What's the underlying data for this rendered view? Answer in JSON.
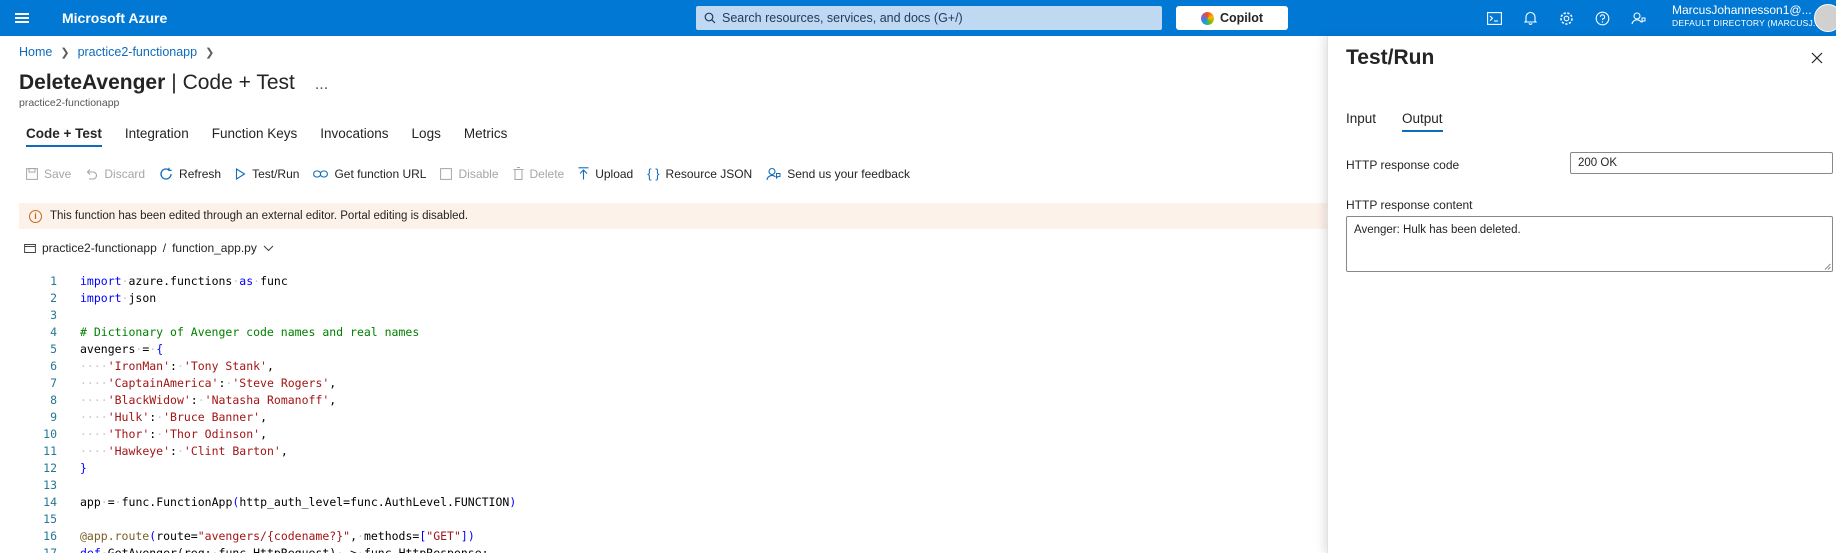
{
  "topbar": {
    "brand": "Microsoft Azure",
    "search_placeholder": "Search resources, services, and docs (G+/)",
    "copilot_label": "Copilot",
    "account_name": "MarcusJohannesson1@...",
    "account_directory": "DEFAULT DIRECTORY (MARCUSJ...",
    "icons": [
      "cloud-shell-icon",
      "bell-icon",
      "gear-icon",
      "help-icon",
      "feedback-icon"
    ]
  },
  "breadcrumb": {
    "home": "Home",
    "app": "practice2-functionapp"
  },
  "header": {
    "title_bold": "DeleteAvenger",
    "title_rest": "| Code + Test",
    "more": "...",
    "subtitle": "practice2-functionapp"
  },
  "tabs": [
    "Code + Test",
    "Integration",
    "Function Keys",
    "Invocations",
    "Logs",
    "Metrics"
  ],
  "toolbar": {
    "save": "Save",
    "discard": "Discard",
    "refresh": "Refresh",
    "test_run": "Test/Run",
    "get_url": "Get function URL",
    "disable": "Disable",
    "delete": "Delete",
    "upload": "Upload",
    "resource_json": "Resource JSON",
    "feedback": "Send us your feedback"
  },
  "banner": {
    "text": "This function has been edited through an external editor. Portal editing is disabled."
  },
  "filepath": {
    "app": "practice2-functionapp",
    "sep": "/",
    "file": "function_app.py"
  },
  "panel": {
    "title": "Test/Run",
    "tabs": {
      "input": "Input",
      "output": "Output"
    },
    "response_code_label": "HTTP response code",
    "response_code_value": "200 OK",
    "response_content_label": "HTTP response content",
    "response_content_value": "Avenger: Hulk has been deleted."
  },
  "colors": {
    "azure_blue": "#0078d4",
    "link": "#0f6cbd",
    "banner_bg": "#fdf2ea"
  }
}
